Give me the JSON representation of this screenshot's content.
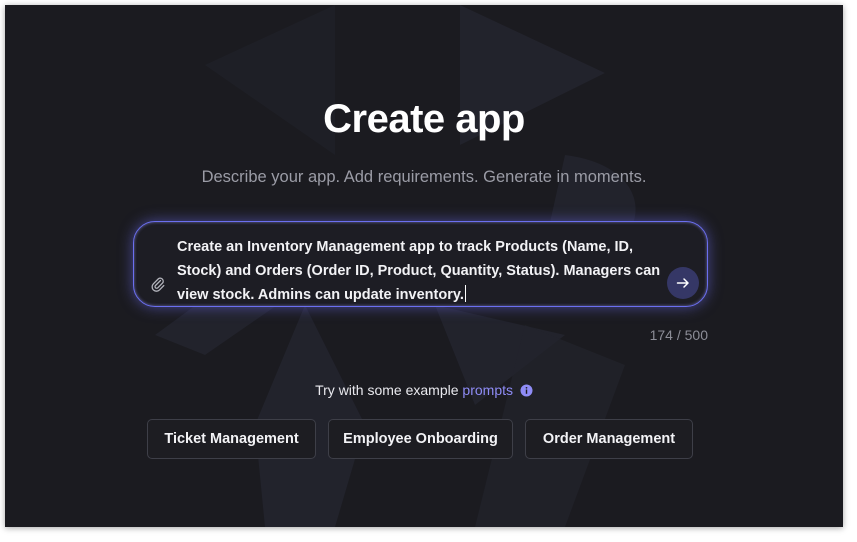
{
  "page": {
    "title": "Create app",
    "subtitle": "Describe your app. Add requirements. Generate in moments."
  },
  "prompt": {
    "text": "Create an Inventory Management app to track Products (Name, ID, Stock) and Orders (Order ID, Product, Quantity, Status). Managers can view stock. Admins can update inventory.",
    "char_count": "174 / 500"
  },
  "examples": {
    "intro": "Try with some example",
    "link_label": "prompts",
    "buttons": [
      "Ticket Management",
      "Employee Onboarding",
      "Order Management"
    ]
  },
  "icons": {
    "attach": "paperclip-icon",
    "send": "arrow-right-icon",
    "info": "info-icon"
  },
  "colors": {
    "background": "#1b1b20",
    "accent": "#8f8cf6",
    "prompt_border": "#6b6ff0",
    "send_button": "#353766"
  }
}
